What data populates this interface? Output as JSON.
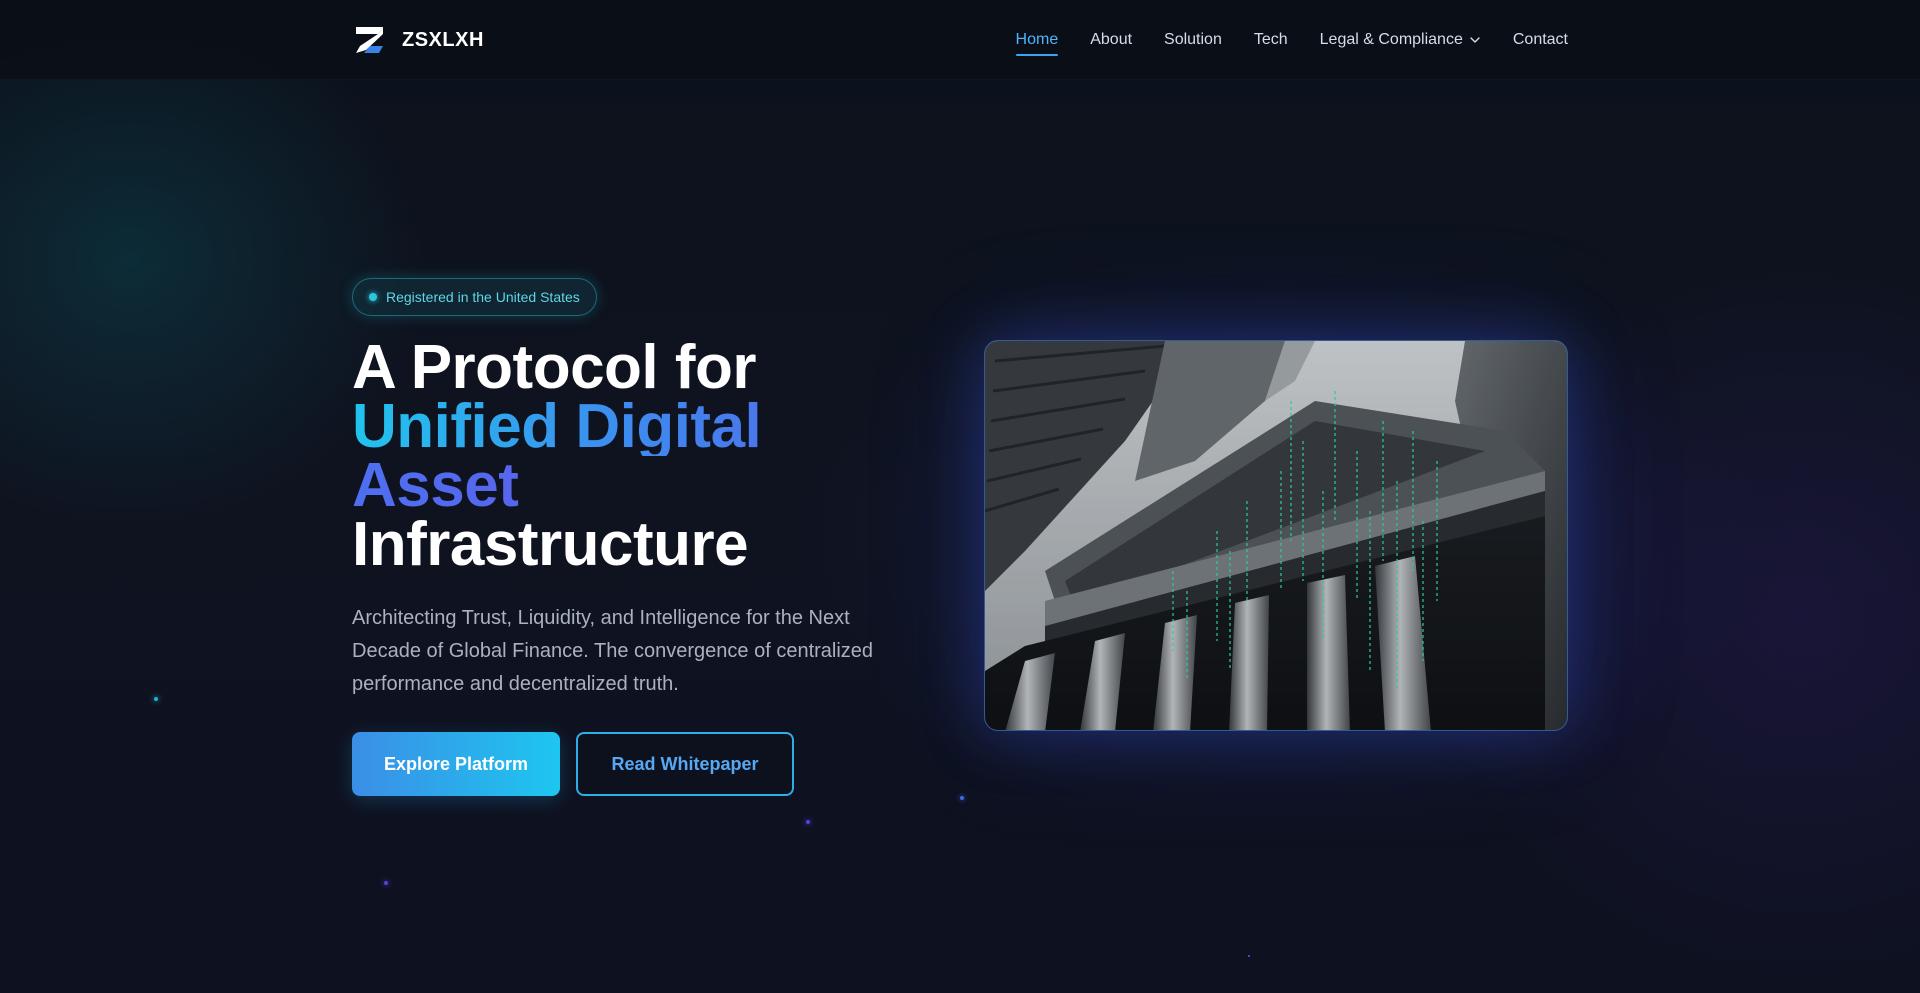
{
  "brand": {
    "name": "ZSXLXH",
    "logo_icon": "zsx-logo-icon"
  },
  "nav": {
    "items": [
      {
        "label": "Home",
        "active": true
      },
      {
        "label": "About",
        "active": false
      },
      {
        "label": "Solution",
        "active": false
      },
      {
        "label": "Tech",
        "active": false
      },
      {
        "label": "Legal & Compliance",
        "active": false,
        "icon": "chevron-down-icon"
      },
      {
        "label": "Contact",
        "active": false
      }
    ]
  },
  "hero": {
    "badge": "Registered in the United States",
    "title_line1": "A Protocol for",
    "title_line2": "Unified Digital",
    "title_line3": "Asset",
    "title_line4": "Infrastructure",
    "subtitle": "Architecting Trust, Liquidity, and Intelligence for the Next Decade of Global Finance. The convergence of centralized performance and decentralized truth.",
    "primary_button": "Explore Platform",
    "secondary_button": "Read Whitepaper",
    "image_subject": "stock-exchange-columns-with-digital-rain"
  },
  "colors": {
    "accent": "#3ea2f0",
    "gradient_start": "#22c3ee",
    "gradient_end": "#6b4fe6",
    "badge": "#2cc7dd",
    "background": "#0d111b"
  }
}
